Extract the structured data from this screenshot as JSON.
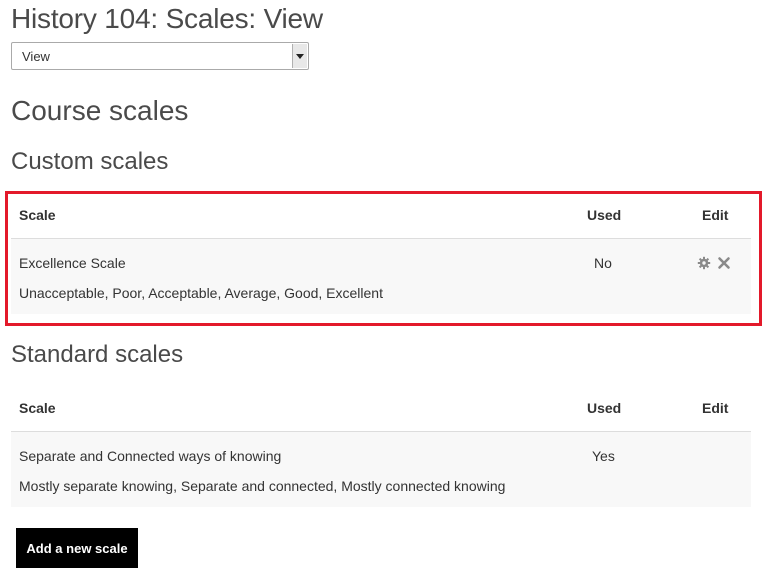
{
  "page": {
    "title": "History 104: Scales: View"
  },
  "view_select": {
    "selected": "View"
  },
  "headings": {
    "course_scales": "Course scales",
    "custom_scales": "Custom scales",
    "standard_scales": "Standard scales"
  },
  "table_headers": {
    "scale": "Scale",
    "used": "Used",
    "edit": "Edit"
  },
  "custom_scales": [
    {
      "name": "Excellence Scale",
      "items": "Unacceptable, Poor, Acceptable, Average, Good, Excellent",
      "used": "No",
      "edit_icons": [
        "gear-icon",
        "delete-x-icon"
      ]
    }
  ],
  "standard_scales": [
    {
      "name": "Separate and Connected ways of knowing",
      "items": "Mostly separate knowing, Separate and connected, Mostly connected knowing",
      "used": "Yes"
    }
  ],
  "actions": {
    "add_new_scale": "Add a new scale"
  },
  "colors": {
    "highlight": "#e3192a",
    "button_bg": "#000000",
    "row_bg": "#f8f8f8",
    "icon": "#8a8a8a"
  }
}
